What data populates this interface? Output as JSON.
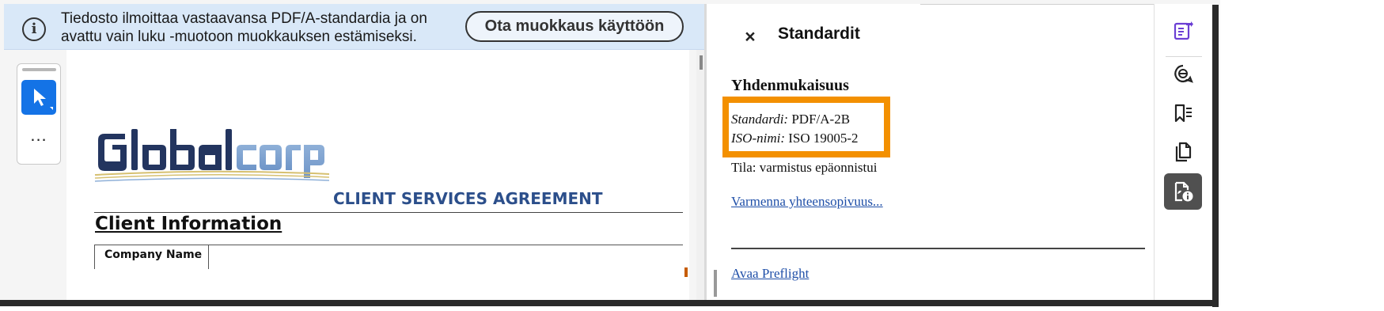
{
  "banner": {
    "message": "Tiedosto ilmoittaa vastaavansa PDF/A-standardia ja on avattu vain luku -muotoon muokkauksen estämiseksi.",
    "enable_editing_label": "Ota muokkaus käyttöön",
    "icon": "info-icon"
  },
  "toolbar": {
    "tools": [
      "select-tool-icon",
      "more-tools-icon"
    ],
    "more_label": "..."
  },
  "document": {
    "logo_text": "globalcorp",
    "agreement_title": "CLIENT SERVICES AGREEMENT",
    "section_heading": "Client Information",
    "first_field_label": "Company Name"
  },
  "panel": {
    "close_label": "×",
    "title": "Standardit",
    "section_heading": "Yhdenmukaisuus",
    "standard_label": "Standardi:",
    "standard_value": "PDF/A-2B",
    "iso_label": "ISO-nimi:",
    "iso_value": "ISO 19005-2",
    "status_text": "Tila: varmistus epäonnistui",
    "verify_link": "Varmenna yhteensopivuus...",
    "preflight_link": "Avaa Preflight",
    "highlight_color": "#f39000"
  },
  "rail": {
    "buttons": [
      "edit-pdf-icon",
      "comment-icon",
      "bookmarks-icon",
      "pages-icon",
      "standards-icon"
    ],
    "active": "standards-icon",
    "accent_color": "#6b3fd4"
  }
}
